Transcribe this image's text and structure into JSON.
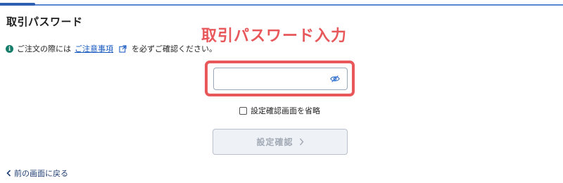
{
  "section": {
    "title": "取引パスワード"
  },
  "annotation": {
    "text": "取引パスワード入力",
    "color": "#e8585b"
  },
  "notice": {
    "prefix": "ご注文の際には",
    "link": "ご注意事項",
    "suffix": "を必ずご確認ください。",
    "icon": "info-icon"
  },
  "password": {
    "value": "",
    "placeholder": "",
    "toggle_icon": "eye-slash-icon"
  },
  "skip_confirm": {
    "label": "設定確認画面を省略",
    "checked": false
  },
  "confirm_button": {
    "label": "設定確認",
    "icon": "chevron-right-icon",
    "disabled": true
  },
  "back_link": {
    "label": "前の画面に戻る",
    "icon": "chevron-left-icon"
  },
  "colors": {
    "accent": "#2f5fb3",
    "link": "#1557c0",
    "annotation": "#e8585b",
    "info": "#177d6b"
  }
}
